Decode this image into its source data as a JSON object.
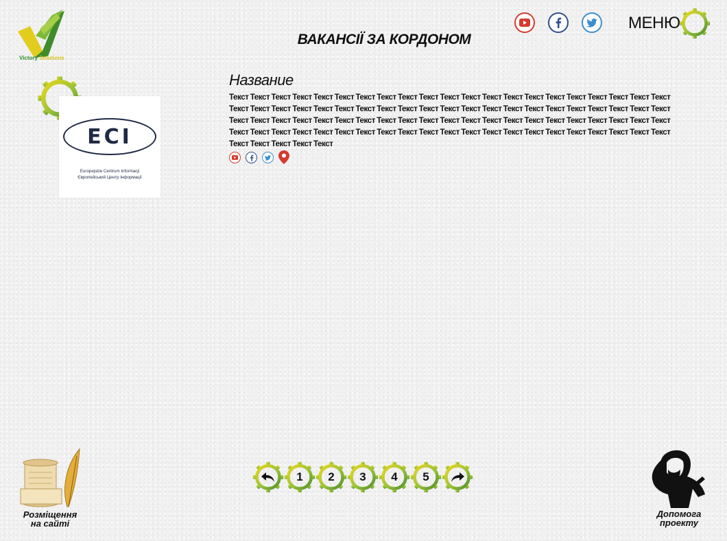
{
  "logo": {
    "text_part1": "Victory",
    "text_part2": "Solutions"
  },
  "header": {
    "title": "ВАКАНСІЇ ЗА КОРДОНОМ",
    "menu_label": "МЕНЮ"
  },
  "social_icons": [
    "youtube-icon",
    "facebook-icon",
    "twitter-icon"
  ],
  "company": {
    "logo_text": "ECI",
    "line1": "Europejskie Centrum Informacji",
    "line2": "Європейський Центр Інформації"
  },
  "item": {
    "title": "Название",
    "text": "Текст Текст Текст Текст Текст Текст Текст Текст Текст Текст Текст Текст Текст Текст Текст Текст Текст Текст Текст Текст Текст Текст Текст Текст Текст Текст Текст Текст Текст Текст Текст Текст Текст Текст Текст Текст Текст Текст Текст Текст Текст Текст Текст Текст Текст Текст Текст Текст Текст Текст Текст Текст Текст Текст Текст Текст Текст Текст Текст Текст Текст Текст Текст Текст Текст Текст Текст Текст Текст Текст Текст Текст Текст Текст Текст Текст Текст Текст Текст Текст Текст Текст Текст Текст Текст Текст Текст Текст Текст"
  },
  "pagination": {
    "pages": [
      "1",
      "2",
      "3",
      "4",
      "5"
    ],
    "prev_icon": "undo-arrow-icon",
    "next_icon": "redo-arrow-icon"
  },
  "footer": {
    "place_label_line1": "Розміщення",
    "place_label_line2": "на сайті",
    "help_label_line1": "Допомога",
    "help_label_line2": "проекту"
  },
  "colors": {
    "gear_green": "#5a9a2e",
    "gear_yellow": "#e6d31f",
    "youtube": "#d53a2e",
    "facebook": "#2f4f8c",
    "twitter": "#3b8fd0"
  }
}
